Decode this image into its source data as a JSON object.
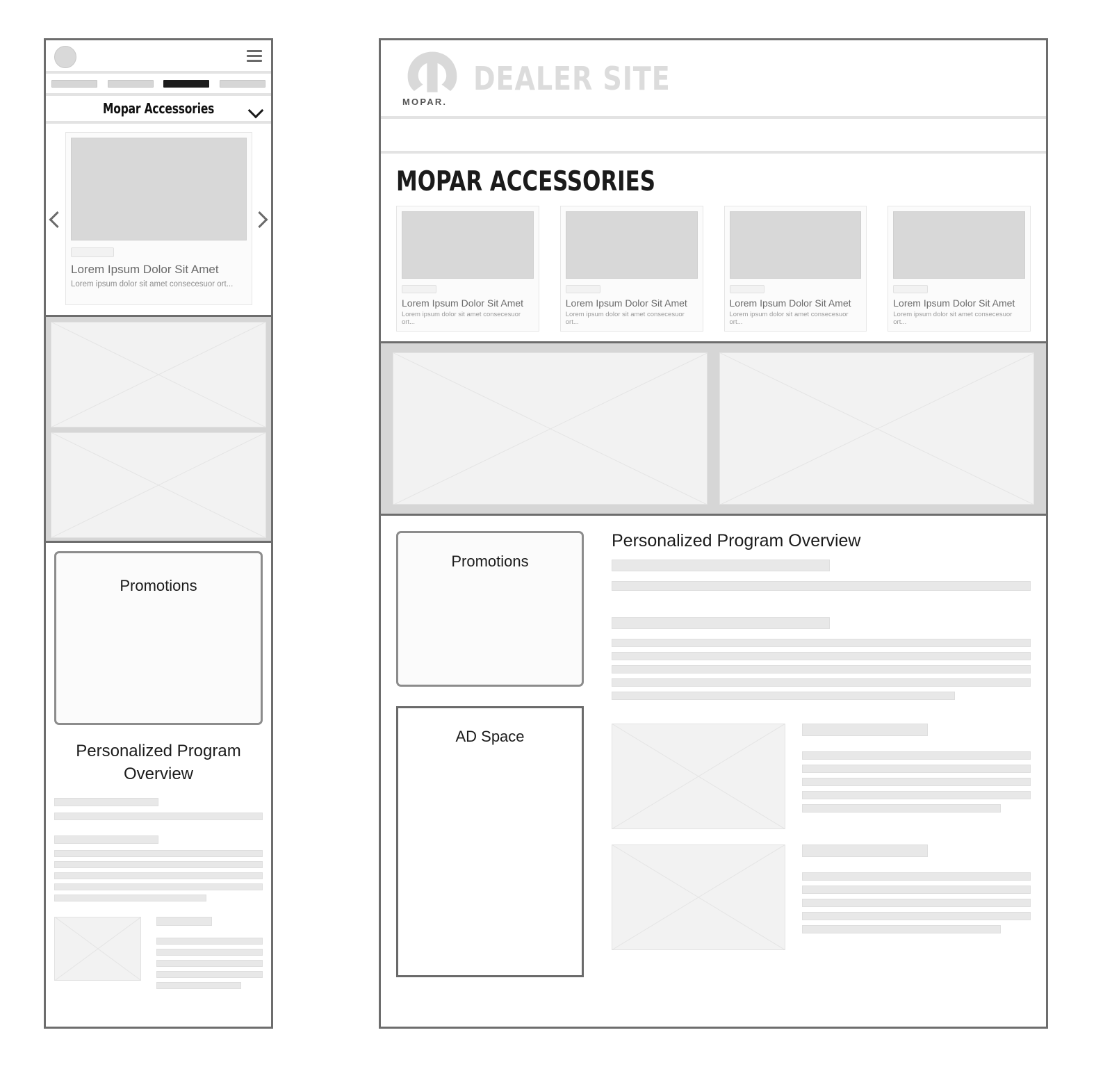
{
  "mobile": {
    "topbar": {
      "avatar": "avatar",
      "menu_icon": "hamburger-menu-icon"
    },
    "nav_pills": [
      {
        "label": "",
        "active": false
      },
      {
        "label": "",
        "active": false
      },
      {
        "label": "",
        "active": true
      },
      {
        "label": "",
        "active": false
      }
    ],
    "section_header": {
      "title": "Mopar Accessories",
      "expand_icon": "chevron-down-icon"
    },
    "carousel": {
      "prev_icon": "chevron-left-icon",
      "next_icon": "chevron-right-icon",
      "card": {
        "title": "Lorem Ipsum Dolor Sit Amet",
        "subtitle": "Lorem ipsum dolor sit amet consecesuor ort..."
      }
    },
    "media_placeholders": [
      "image-placeholder",
      "image-placeholder"
    ],
    "promotions_label": "Promotions",
    "ppo_title": "Personalized Program Overview",
    "ppo_line_widths": [
      [
        50,
        100
      ],
      [
        50,
        100,
        100,
        100,
        68
      ]
    ],
    "ppo_media": {
      "heading_width": 45,
      "line_widths": [
        100,
        100,
        100,
        100,
        78
      ]
    }
  },
  "desktop": {
    "header": {
      "logo_icon": "mopar-omega-logo-icon",
      "logo_wordmark": "MOPAR.",
      "brand_title": "DEALER SITE"
    },
    "accessories": {
      "heading": "MOPAR ACCESSORIES",
      "cards": [
        {
          "title": "Lorem Ipsum Dolor Sit Amet",
          "subtitle": "Lorem ipsum dolor sit amet consecesuor ort..."
        },
        {
          "title": "Lorem Ipsum Dolor Sit Amet",
          "subtitle": "Lorem ipsum dolor sit amet consecesuor ort..."
        },
        {
          "title": "Lorem Ipsum Dolor Sit Amet",
          "subtitle": "Lorem ipsum dolor sit amet consecesuor ort..."
        },
        {
          "title": "Lorem Ipsum Dolor Sit Amet",
          "subtitle": "Lorem ipsum dolor sit amet consecesuor ort..."
        }
      ]
    },
    "media_placeholders": [
      "image-placeholder",
      "image-placeholder"
    ],
    "promotions_label": "Promotions",
    "ad_space_label": "AD Space",
    "ppo_title": "Personalized Program Overview",
    "ppo_groups": [
      {
        "lines": [
          52,
          100
        ]
      },
      {
        "lines": [
          52
        ]
      },
      {
        "lines": [
          100,
          100,
          100,
          100,
          82
        ]
      }
    ],
    "ppo_media_rows": [
      {
        "heading_width": 55,
        "line_widths": [
          100,
          100,
          100,
          100,
          87
        ]
      },
      {
        "heading_width": 55,
        "line_widths": [
          100,
          100,
          100,
          100,
          87
        ]
      }
    ]
  },
  "colors": {
    "frame_border": "#6d6d6d",
    "placeholder_fill": "#e8e8e8",
    "media_band": "#d6d6d6",
    "active_pill": "#1c1c1c",
    "brand_text": "#dcdcdc"
  }
}
